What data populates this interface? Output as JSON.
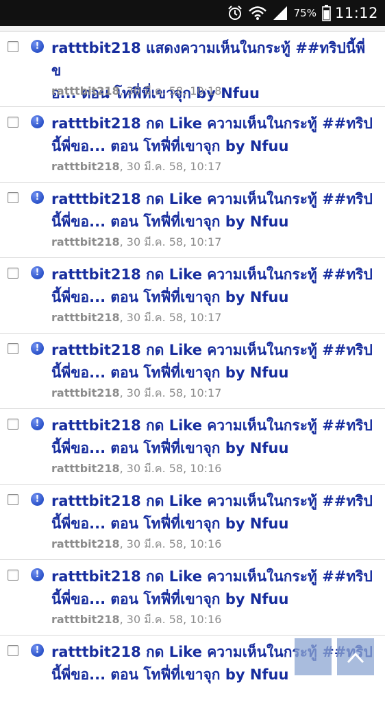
{
  "status_bar": {
    "battery_percent": "75%",
    "time": "11:12",
    "icons": [
      "alarm-icon",
      "wifi-icon",
      "signal-icon",
      "battery-icon"
    ]
  },
  "colors": {
    "title": "#182e9e",
    "meta": "#8c8c8c",
    "unread_icon": "#2b52c8",
    "status_bar_bg": "#111111"
  },
  "notifications": [
    {
      "title": "ratttbit218 แสดงความเห็นในกระทู้ ##ทริปนี้พี่ข\nอ... ตอน โทฟี่ที่เขาจุก by Nfuu",
      "user": "ratttbit218",
      "time": ", 30 มี.ค. 58, 10:18"
    },
    {
      "title": "ratttbit218 กด Like ความเห็นในกระทู้ ##ทริป\nนี้พี่ขอ... ตอน โทฟี่ที่เขาจุก by Nfuu",
      "user": "ratttbit218",
      "time": ", 30 มี.ค. 58, 10:17"
    },
    {
      "title": "ratttbit218 กด Like ความเห็นในกระทู้ ##ทริป\nนี้พี่ขอ... ตอน โทฟี่ที่เขาจุก by Nfuu",
      "user": "ratttbit218",
      "time": ", 30 มี.ค. 58, 10:17"
    },
    {
      "title": "ratttbit218 กด Like ความเห็นในกระทู้ ##ทริป\nนี้พี่ขอ... ตอน โทฟี่ที่เขาจุก by Nfuu",
      "user": "ratttbit218",
      "time": ", 30 มี.ค. 58, 10:17"
    },
    {
      "title": "ratttbit218 กด Like ความเห็นในกระทู้ ##ทริป\nนี้พี่ขอ... ตอน โทฟี่ที่เขาจุก by Nfuu",
      "user": "ratttbit218",
      "time": ", 30 มี.ค. 58, 10:17"
    },
    {
      "title": "ratttbit218 กด Like ความเห็นในกระทู้ ##ทริป\nนี้พี่ขอ... ตอน โทฟี่ที่เขาจุก by Nfuu",
      "user": "ratttbit218",
      "time": ", 30 มี.ค. 58, 10:16"
    },
    {
      "title": "ratttbit218 กด Like ความเห็นในกระทู้ ##ทริป\nนี้พี่ขอ... ตอน โทฟี่ที่เขาจุก by Nfuu",
      "user": "ratttbit218",
      "time": ", 30 มี.ค. 58, 10:16"
    },
    {
      "title": "ratttbit218 กด Like ความเห็นในกระทู้ ##ทริป\nนี้พี่ขอ... ตอน โทฟี่ที่เขาจุก by Nfuu",
      "user": "ratttbit218",
      "time": ", 30 มี.ค. 58, 10:16"
    },
    {
      "title": "ratttbit218 กด Like ความเห็นในกระทู้ ##ทริป\nนี้พี่ขอ... ตอน โทฟี่ที่เขาจุก by Nfuu",
      "user": "",
      "time": ""
    }
  ],
  "floating_buttons": [
    {
      "icon": "page-nav-icon"
    },
    {
      "icon": "scroll-to-top-icon"
    }
  ]
}
